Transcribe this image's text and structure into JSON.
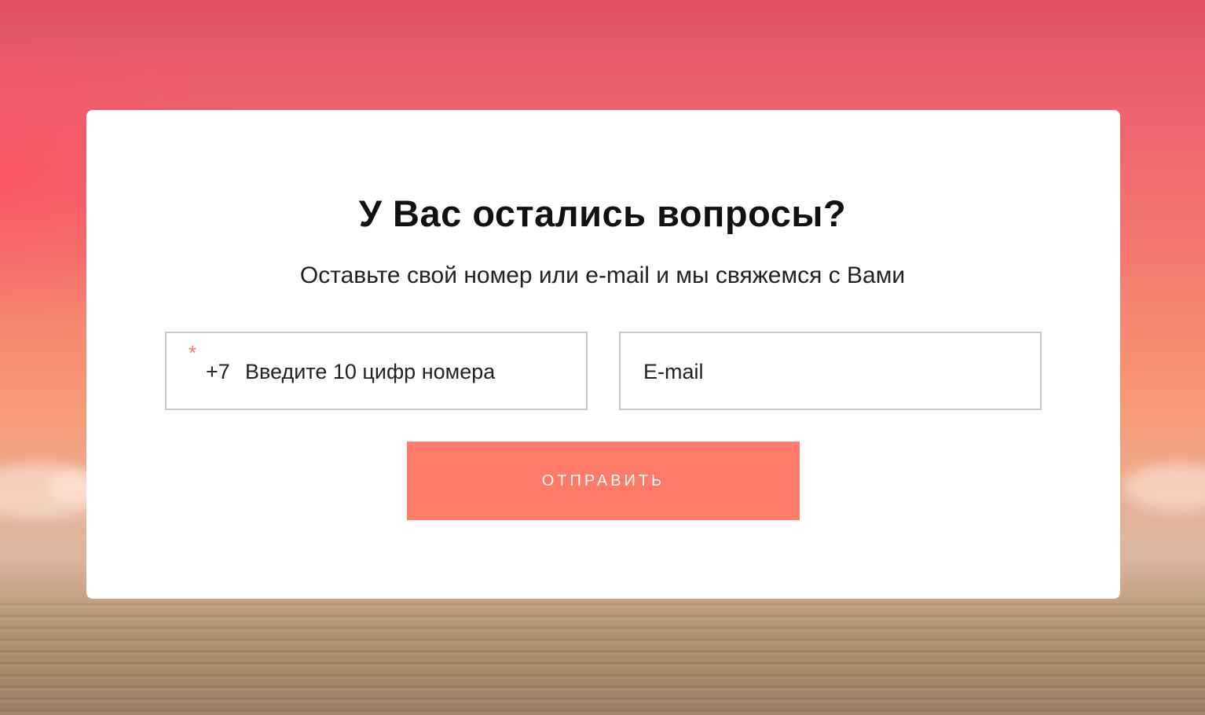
{
  "form": {
    "title": "У Вас остались вопросы?",
    "subtitle": "Оставьте свой номер или e-mail и мы свяжемся с Вами",
    "phone": {
      "required_mark": "*",
      "prefix": "+7",
      "placeholder": "Введите 10 цифр номера",
      "value": ""
    },
    "email": {
      "placeholder": "E-mail",
      "value": ""
    },
    "submit_label": "ОТПРАВИТЬ"
  },
  "colors": {
    "accent": "#ff7a69",
    "field_border": "#c9c9c9",
    "card_bg": "#ffffff",
    "text": "#111111"
  }
}
